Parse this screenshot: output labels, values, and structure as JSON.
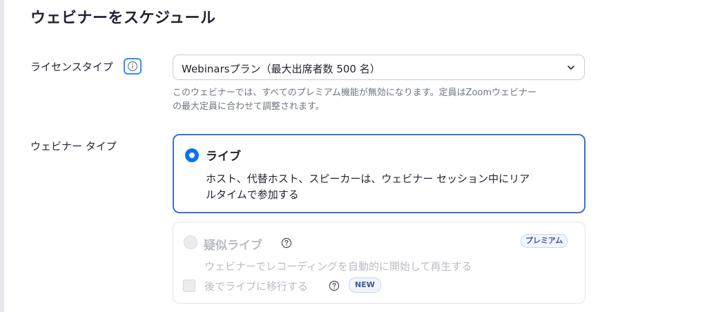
{
  "page": {
    "title": "ウェビナーをスケジュール"
  },
  "license": {
    "label": "ライセンスタイプ",
    "info_icon": "info-icon",
    "selected": "Webinarsプラン（最大出席者数 500 名）",
    "help_line1": "このウェビナーでは、すべてのプレミアム機能が無効になります。定員はZoomウェビナー",
    "help_line2": "の最大定員に合わせて調整されます。"
  },
  "webinar_type": {
    "label": "ウェビナー タイプ",
    "options": [
      {
        "title": "ライブ",
        "description_line1": "ホスト、代替ホスト、スピーカーは、ウェビナー セッション中にリア",
        "description_line2": "ルタイムで参加する",
        "selected": true
      },
      {
        "title": "疑似ライブ",
        "badge": "プレミアム",
        "description": "ウェビナーでレコーディングを自動的に開始して再生する",
        "checkbox_label": "後でライブに移行する",
        "checkbox_badge": "NEW",
        "checked": false,
        "disabled": true
      }
    ]
  },
  "colors": {
    "accent": "#0e72ed",
    "selected_border": "#3b6fd4",
    "muted_text": "#b9bcc4",
    "help_text": "#6e7680"
  }
}
